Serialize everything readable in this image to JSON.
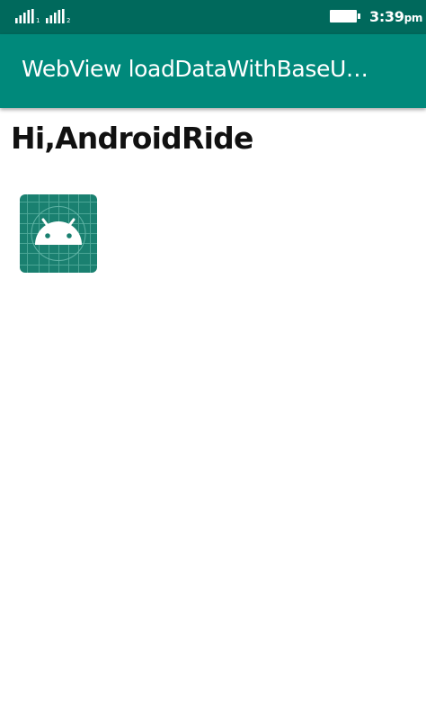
{
  "status_bar": {
    "sim1_label": "1",
    "sim2_label": "2",
    "time": "3:39",
    "time_suffix": "pm"
  },
  "app_bar": {
    "title": "WebView loadDataWithBaseU…"
  },
  "content": {
    "heading": "Hi,AndroidRide"
  },
  "icons": {
    "sim1_signal": "signal-bars-icon",
    "sim2_signal": "signal-bars-icon",
    "battery": "battery-full-icon",
    "image": "android-launcher-icon"
  },
  "colors": {
    "status_bar": "#00695c",
    "app_bar": "#00897b",
    "icon_background": "#1a8070"
  }
}
